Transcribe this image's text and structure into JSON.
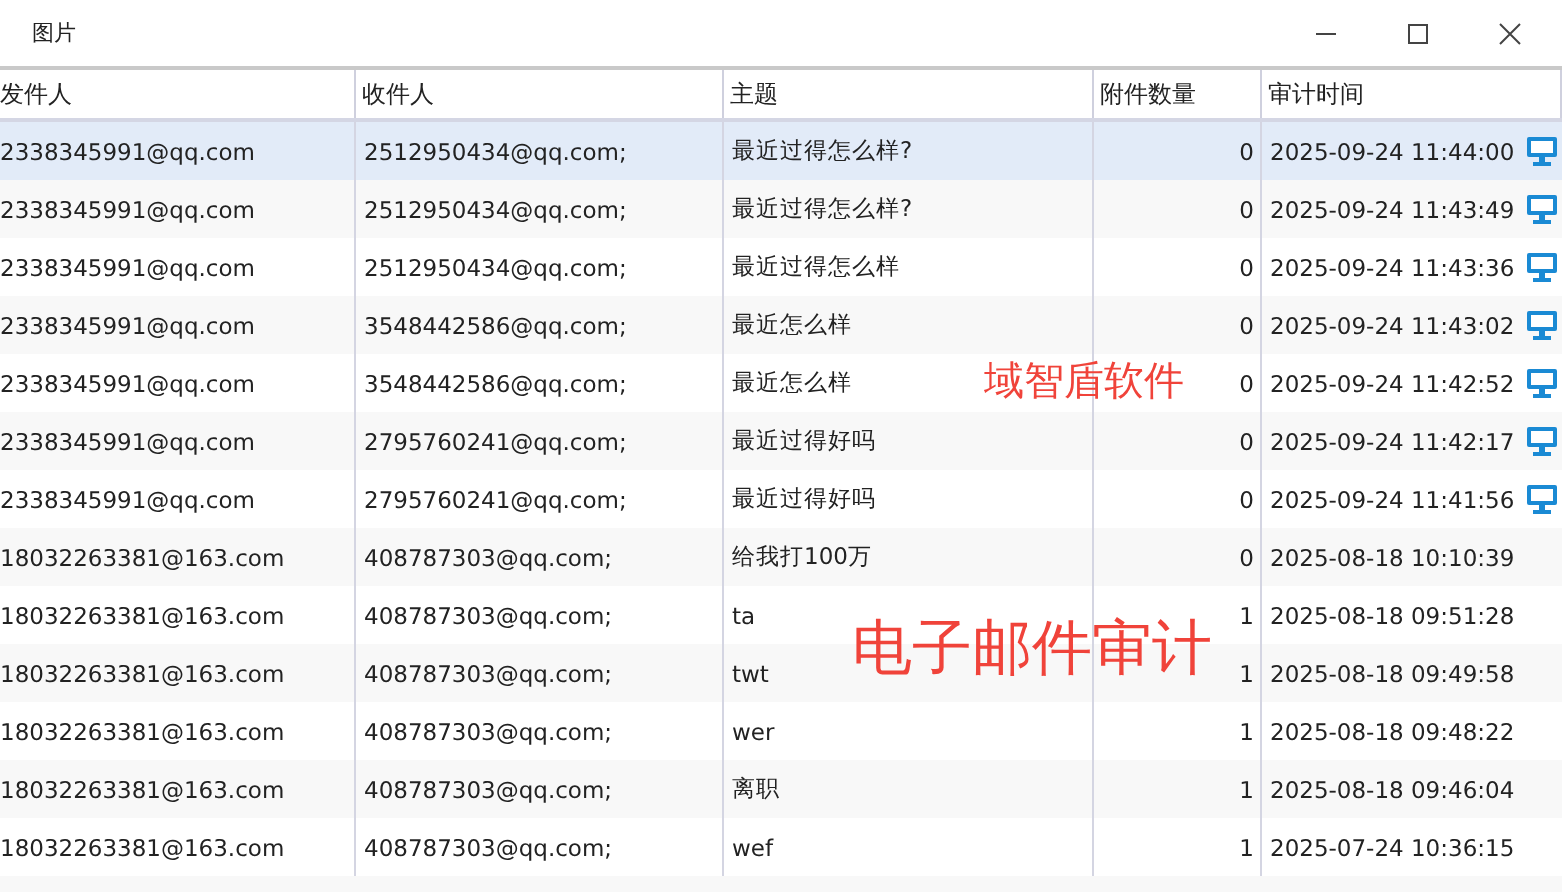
{
  "window": {
    "title": "图片"
  },
  "table": {
    "columns": [
      "发件人",
      "收件人",
      "主题",
      "附件数量",
      "审计时间"
    ],
    "rows": [
      {
        "sender": "2338345991@qq.com",
        "recipient": "2512950434@qq.com;",
        "subject": "最近过得怎么样?",
        "attachments": "0",
        "time": "2025-09-24 11:44:00",
        "client_icon": true,
        "selected": true
      },
      {
        "sender": "2338345991@qq.com",
        "recipient": "2512950434@qq.com;",
        "subject": "最近过得怎么样?",
        "attachments": "0",
        "time": "2025-09-24 11:43:49",
        "client_icon": true,
        "selected": false
      },
      {
        "sender": "2338345991@qq.com",
        "recipient": "2512950434@qq.com;",
        "subject": "最近过得怎么样",
        "attachments": "0",
        "time": "2025-09-24 11:43:36",
        "client_icon": true,
        "selected": false
      },
      {
        "sender": "2338345991@qq.com",
        "recipient": "3548442586@qq.com;",
        "subject": "最近怎么样",
        "attachments": "0",
        "time": "2025-09-24 11:43:02",
        "client_icon": true,
        "selected": false
      },
      {
        "sender": "2338345991@qq.com",
        "recipient": "3548442586@qq.com;",
        "subject": "最近怎么样",
        "attachments": "0",
        "time": "2025-09-24 11:42:52",
        "client_icon": true,
        "selected": false
      },
      {
        "sender": "2338345991@qq.com",
        "recipient": "2795760241@qq.com;",
        "subject": "最近过得好吗",
        "attachments": "0",
        "time": "2025-09-24 11:42:17",
        "client_icon": true,
        "selected": false
      },
      {
        "sender": "2338345991@qq.com",
        "recipient": "2795760241@qq.com;",
        "subject": "最近过得好吗",
        "attachments": "0",
        "time": "2025-09-24 11:41:56",
        "client_icon": true,
        "selected": false
      },
      {
        "sender": "18032263381@163.com",
        "recipient": "408787303@qq.com;",
        "subject": "给我打100万",
        "attachments": "0",
        "time": "2025-08-18 10:10:39",
        "client_icon": false,
        "selected": false
      },
      {
        "sender": "18032263381@163.com",
        "recipient": "408787303@qq.com;",
        "subject": "ta",
        "attachments": "1",
        "time": "2025-08-18 09:51:28",
        "client_icon": false,
        "selected": false
      },
      {
        "sender": "18032263381@163.com",
        "recipient": "408787303@qq.com;",
        "subject": "twt",
        "attachments": "1",
        "time": "2025-08-18 09:49:58",
        "client_icon": false,
        "selected": false
      },
      {
        "sender": "18032263381@163.com",
        "recipient": "408787303@qq.com;",
        "subject": "wer",
        "attachments": "1",
        "time": "2025-08-18 09:48:22",
        "client_icon": false,
        "selected": false
      },
      {
        "sender": "18032263381@163.com",
        "recipient": "408787303@qq.com;",
        "subject": "离职",
        "attachments": "1",
        "time": "2025-08-18 09:46:04",
        "client_icon": false,
        "selected": false
      },
      {
        "sender": "18032263381@163.com",
        "recipient": "408787303@qq.com;",
        "subject": "wef",
        "attachments": "1",
        "time": "2025-07-24 10:36:15",
        "client_icon": false,
        "selected": false
      }
    ]
  },
  "annotations": [
    "域智盾软件",
    "电子邮件审计"
  ]
}
